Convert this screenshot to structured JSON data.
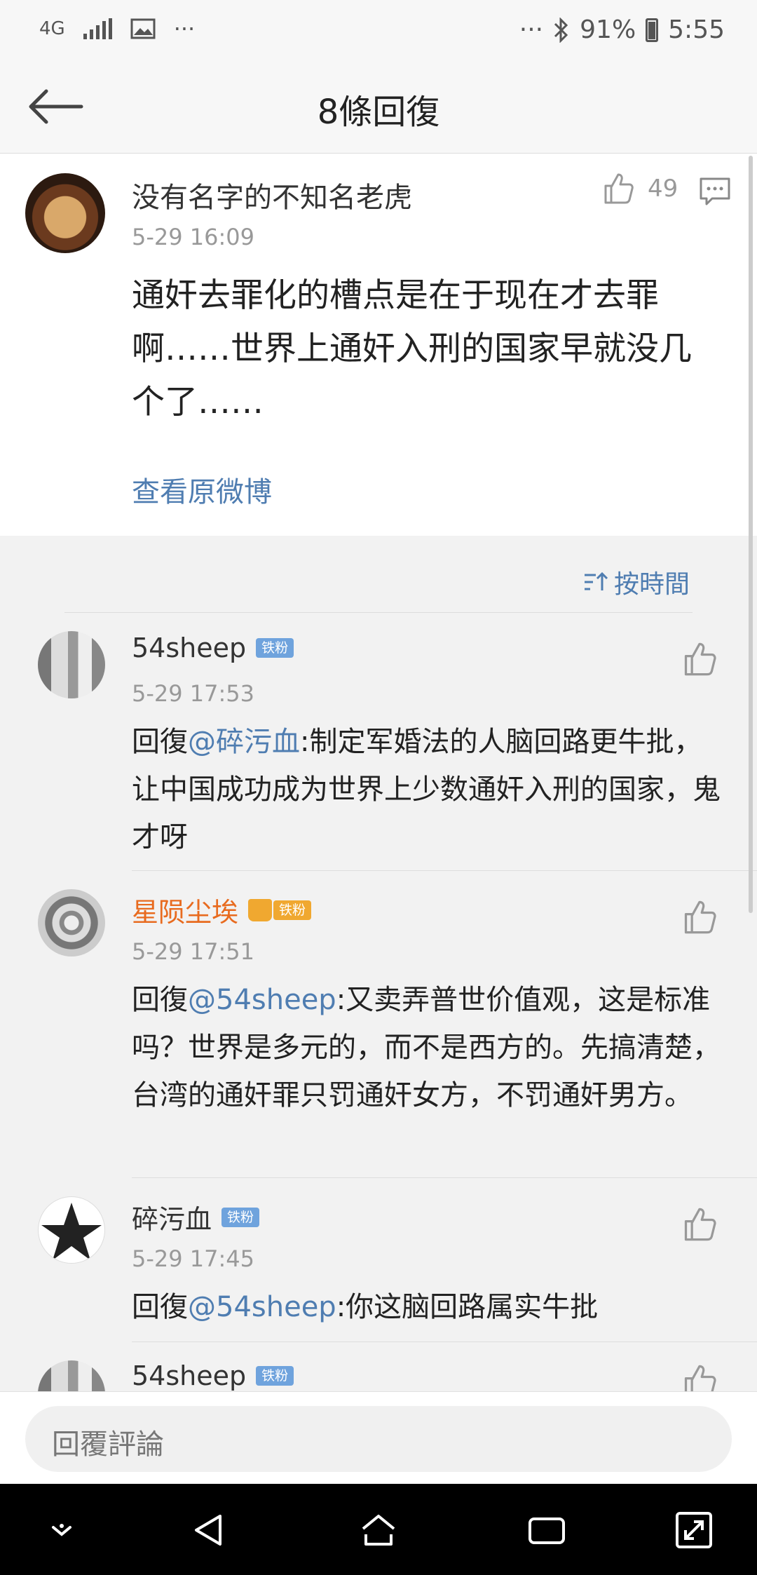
{
  "status_bar": {
    "network": "4G",
    "more": "···",
    "more_right": "···",
    "battery": "91%",
    "time": "5:55"
  },
  "header": {
    "title": "8條回復"
  },
  "post": {
    "author": "没有名字的不知名老虎",
    "time": "5-29 16:09",
    "like_count": "49",
    "text": "通奸去罪化的槽点是在于现在才去罪啊……世界上通奸入刑的国家早就没几个了……",
    "view_original": "查看原微博"
  },
  "sort": {
    "label": "按時間"
  },
  "replies": [
    {
      "name": "54sheep",
      "badge": "铁粉",
      "time": "5-29 17:53",
      "reply_prefix": "回復",
      "mention": "@碎污血",
      "text": ":制定军婚法的人脑回路更牛批，让中国成功成为世界上少数通奸入刑的国家，鬼才呀"
    },
    {
      "name": "星陨尘埃",
      "badge": "铁粉",
      "time": "5-29 17:51",
      "reply_prefix": "回復",
      "mention": "@54sheep",
      "text": ":又卖弄普世价值观，这是标准吗？世界是多元的，而不是西方的。先搞清楚，台湾的通奸罪只罚通奸女方，不罚通奸男方。"
    },
    {
      "name": "碎污血",
      "badge": "铁粉",
      "time": "5-29 17:45",
      "reply_prefix": "回復",
      "mention": "@54sheep",
      "text": ":你这脑回路属实牛批"
    },
    {
      "name": "54sheep",
      "badge": "铁粉"
    }
  ],
  "input": {
    "placeholder": "回覆評論"
  },
  "colors": {
    "link": "#4f7db1",
    "vip_name": "#e86b1f",
    "badge": "#6fa3dd"
  }
}
